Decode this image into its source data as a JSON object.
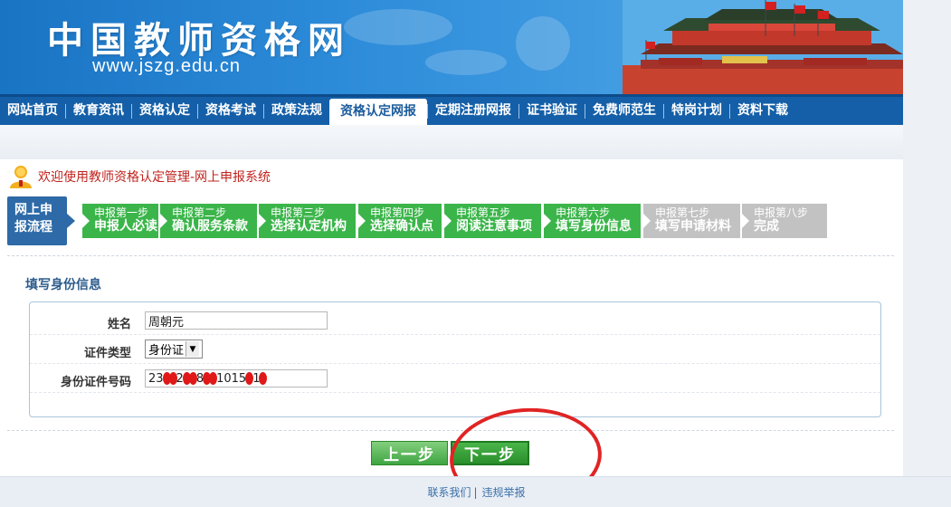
{
  "header": {
    "site_title": "中国教师资格网",
    "site_url": "www.jszg.edu.cn"
  },
  "nav": {
    "items": [
      {
        "label": "网站首页"
      },
      {
        "label": "教育资讯"
      },
      {
        "label": "资格认定"
      },
      {
        "label": "资格考试"
      },
      {
        "label": "政策法规"
      },
      {
        "label": "资格认定网报",
        "active": true
      },
      {
        "label": "定期注册网报"
      },
      {
        "label": "证书验证"
      },
      {
        "label": "免费师范生"
      },
      {
        "label": "特岗计划"
      },
      {
        "label": "资料下载"
      }
    ]
  },
  "welcome": {
    "text": "欢迎使用教师资格认定管理-网上申报系统",
    "icon": "user-icon"
  },
  "flow": {
    "label_line1": "网上申",
    "label_line2": "报流程",
    "steps": [
      {
        "title": "申报第一步",
        "desc": "申报人必读",
        "status": "done"
      },
      {
        "title": "申报第二步",
        "desc": "确认服务条款",
        "status": "done"
      },
      {
        "title": "申报第三步",
        "desc": "选择认定机构",
        "status": "done"
      },
      {
        "title": "申报第四步",
        "desc": "选择确认点",
        "status": "done"
      },
      {
        "title": "申报第五步",
        "desc": "阅读注意事项",
        "status": "done"
      },
      {
        "title": "申报第六步",
        "desc": "填写身份信息",
        "status": "done"
      },
      {
        "title": "申报第七步",
        "desc": "填写申请材料",
        "status": "todo"
      },
      {
        "title": "申报第八步",
        "desc": "完成",
        "status": "todo"
      }
    ]
  },
  "form": {
    "section_title": "填写身份信息",
    "name_label": "姓名",
    "name_value": "周朝元",
    "id_type_label": "证件类型",
    "id_type_value": "身份证",
    "id_number_label": "身份证件号码",
    "id_number_visible_parts": [
      "23",
      "2",
      "8",
      "1015",
      "1"
    ]
  },
  "buttons": {
    "prev_label": "上一步",
    "next_label": "下一步"
  },
  "footer": {
    "contact": "联系我们",
    "separator": "|",
    "report": "违规举报"
  },
  "colors": {
    "nav_bg": "#145fa8",
    "step_done": "#3bb54a",
    "step_todo": "#c2c2c2",
    "welcome_text": "#c0241f",
    "annotation": "#e02424"
  }
}
